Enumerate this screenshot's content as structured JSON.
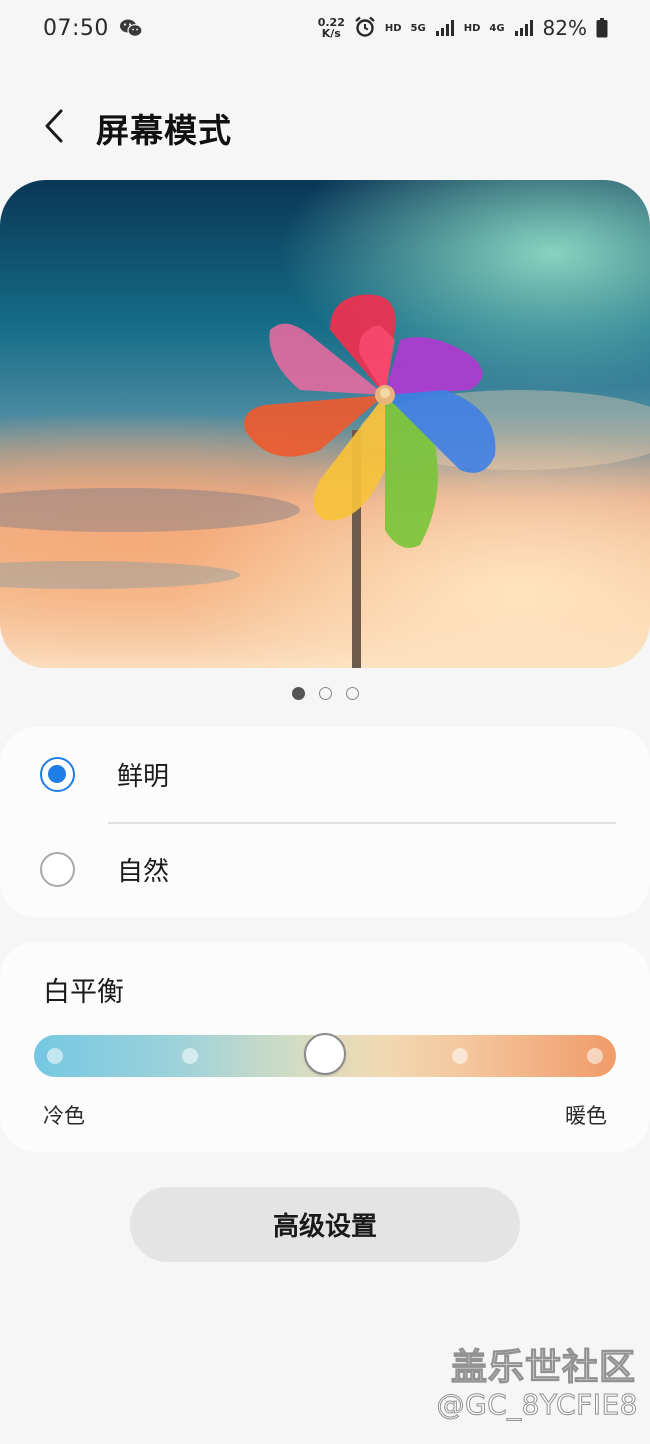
{
  "status_bar": {
    "time": "07:50",
    "net_speed_value": "0.22",
    "net_speed_unit": "K/s",
    "hd1": "HD",
    "net1": "5G",
    "hd2": "HD",
    "net2": "4G",
    "battery": "82%",
    "icons": [
      "wechat-icon",
      "alarm-icon",
      "signal-icon",
      "battery-icon"
    ]
  },
  "header": {
    "back_icon": "chevron-left-icon",
    "title": "屏幕模式"
  },
  "preview": {
    "page_count": 3,
    "active_page": 1
  },
  "screen_modes": {
    "options": [
      {
        "label": "鲜明",
        "selected": true
      },
      {
        "label": "自然",
        "selected": false
      }
    ]
  },
  "white_balance": {
    "title": "白平衡",
    "cool_label": "冷色",
    "warm_label": "暖色",
    "steps": 5,
    "value_step": 3
  },
  "advanced_button": {
    "label": "高级设置"
  },
  "watermark": {
    "title": "盖乐世社区",
    "user": "@GC_8YCFIE8"
  },
  "colors": {
    "accent": "#1f7ee6",
    "background": "#f6f6f6",
    "card": "#fcfcfc"
  }
}
